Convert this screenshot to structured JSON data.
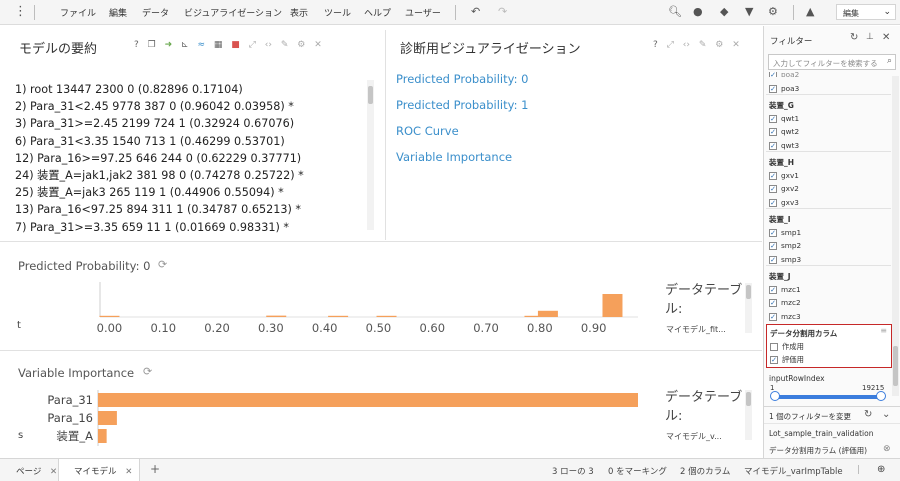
{
  "menubar": {
    "items": [
      "ファイル",
      "編集",
      "データ",
      "ビジュアライゼーション",
      "表示",
      "ツール",
      "ヘルプ",
      "ユーザー"
    ],
    "view_select": "編集"
  },
  "summary_panel": {
    "title": "モデルの要約",
    "lines": [
      "1) root 13447 2300 0 (0.82896 0.17104)",
      "2) Para_31<2.45 9778 387 0 (0.96042 0.03958) *",
      "3) Para_31>=2.45 2199 724 1 (0.32924 0.67076)",
      "6) Para_31<3.35 1540 713 1 (0.46299 0.53701)",
      "12) Para_16>=97.25 646 244 0 (0.62229 0.37771)",
      "24) 装置_A=jak1,jak2 381 98 0 (0.74278 0.25722) *",
      "25) 装置_A=jak3 265 119 1 (0.44906 0.55094) *",
      "13) Para_16<97.25 894 311 1 (0.34787 0.65213) *",
      "7) Para_31>=3.35 659 11 1 (0.01669 0.98331) *"
    ]
  },
  "diag_panel": {
    "title": "診断用ビジュアライゼーション",
    "links": [
      "Predicted Probability: 0",
      "Predicted Probability: 1",
      "ROC Curve",
      "Variable Importance"
    ]
  },
  "prob_chart": {
    "title": "Predicted Probability: 0",
    "side_label": "データテーブル:",
    "side_sub": "マイモデル_fit...",
    "y_stub": "t"
  },
  "varimp_chart": {
    "title": "Variable Importance",
    "side_label": "データテーブル:",
    "side_sub": "マイモデル_v...",
    "y_stub": "s"
  },
  "chart_data": [
    {
      "type": "bar",
      "title": "Predicted Probability: 0",
      "x_ticks": [
        "0.00",
        "0.10",
        "0.20",
        "0.30",
        "0.40",
        "0.50",
        "0.60",
        "0.70",
        "0.80",
        "0.90"
      ],
      "xlim": [
        -0.025,
        0.975
      ],
      "bins": [
        {
          "x": 0.0,
          "height": 0.04
        },
        {
          "x": 0.31,
          "height": 0.06
        },
        {
          "x": 0.425,
          "height": 0.02
        },
        {
          "x": 0.515,
          "height": 0.02
        },
        {
          "x": 0.79,
          "height": 0.05
        },
        {
          "x": 0.815,
          "height": 0.27
        },
        {
          "x": 0.935,
          "height": 1.0
        }
      ],
      "color": "#f5a05b"
    },
    {
      "type": "bar",
      "orientation": "horizontal",
      "title": "Variable Importance",
      "categories": [
        "Para_31",
        "Para_16",
        "装置_A"
      ],
      "values": [
        1.0,
        0.035,
        0.016
      ],
      "color": "#f5a05b"
    }
  ],
  "filter_panel": {
    "title": "フィルター",
    "search_placeholder": "入力してフィルターを検索する",
    "top_partial": "poa2",
    "top_item": "poa3",
    "groups": [
      {
        "name": "装置_G",
        "items": [
          "qwt1",
          "qwt2",
          "qwt3"
        ]
      },
      {
        "name": "装置_H",
        "items": [
          "gxv1",
          "gxv2",
          "gxv3"
        ]
      },
      {
        "name": "装置_I",
        "items": [
          "smp1",
          "smp2",
          "smp3"
        ]
      },
      {
        "name": "装置_J",
        "items": [
          "mzc1",
          "mzc2",
          "mzc3"
        ]
      }
    ],
    "split_column": {
      "name": "データ分割用カラム",
      "items": [
        {
          "label": "作成用",
          "checked": false
        },
        {
          "label": "評価用",
          "checked": true
        }
      ]
    },
    "input_row_index": {
      "label": "inputRowIndex",
      "min": "1",
      "max": "19215"
    },
    "changed_count": "1 個のフィルターを変更",
    "lot_label": "Lot_sample_train_validation",
    "applied_filter": "データ分割用カラム (評価用)"
  },
  "tabbar": {
    "tabs": [
      "ページ",
      "マイモデル"
    ],
    "status": [
      "3 ローの 3",
      "0 をマーキング",
      "2 個のカラム",
      "マイモデル_varImpTable"
    ]
  },
  "colors": {
    "accent": "#3b8fcb",
    "bar": "#f5a05b",
    "highlight_border": "#c62828"
  }
}
